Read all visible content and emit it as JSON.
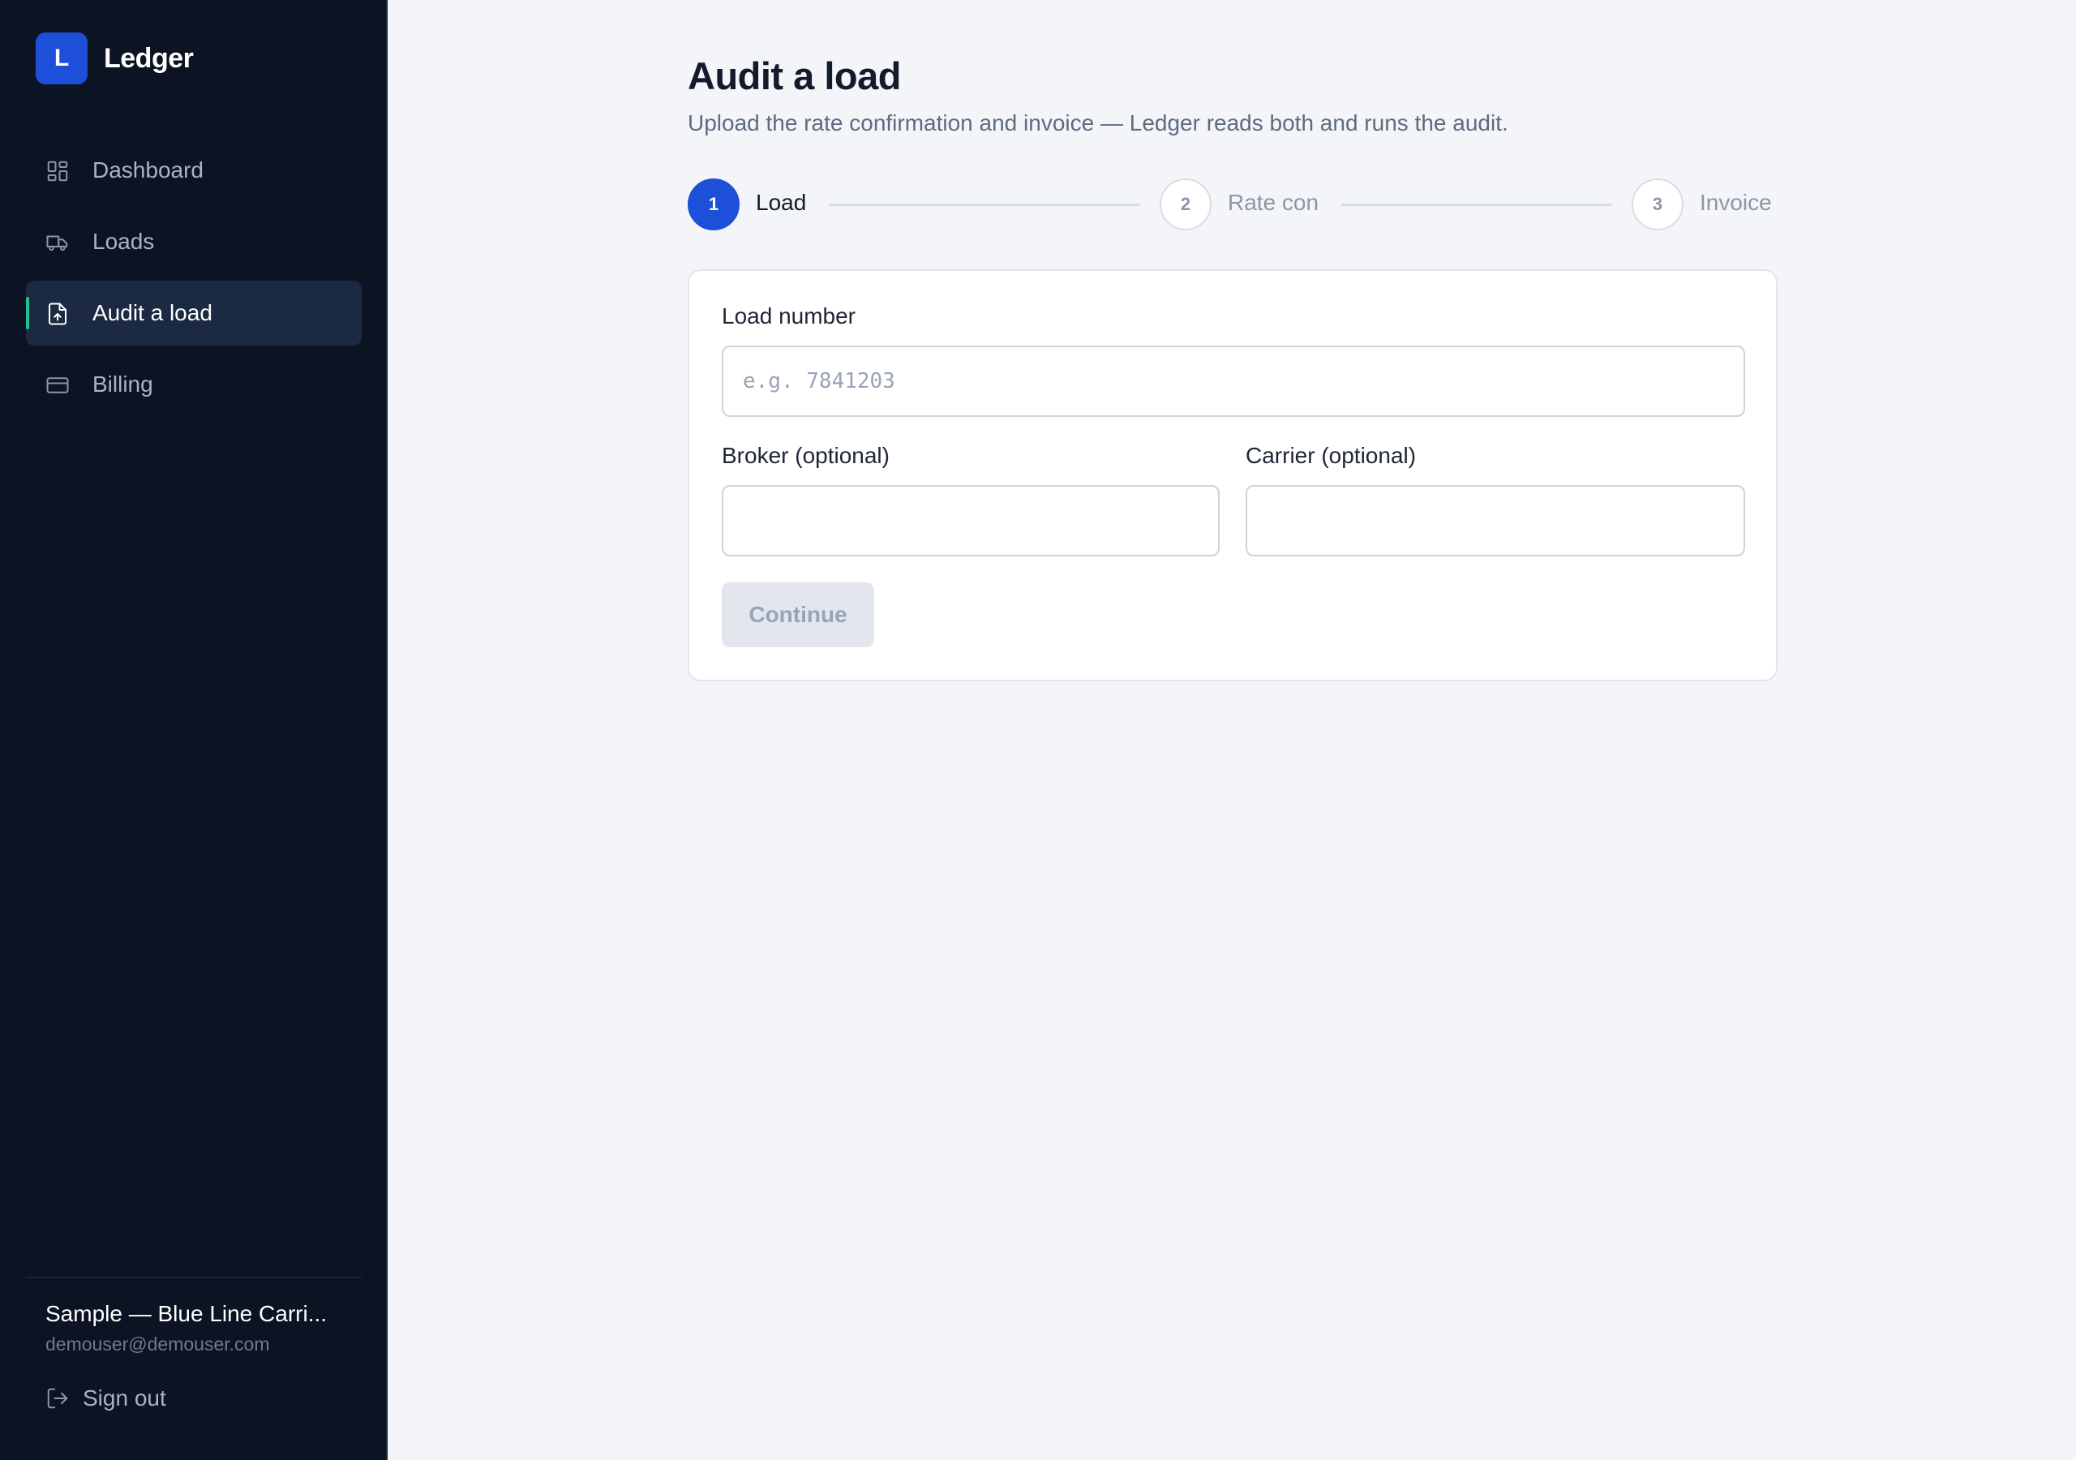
{
  "app": {
    "logo_letter": "L",
    "name": "Ledger"
  },
  "sidebar": {
    "items": [
      {
        "label": "Dashboard",
        "icon": "dashboard-icon",
        "active": false
      },
      {
        "label": "Loads",
        "icon": "truck-icon",
        "active": false
      },
      {
        "label": "Audit a load",
        "icon": "file-upload-icon",
        "active": true
      },
      {
        "label": "Billing",
        "icon": "credit-card-icon",
        "active": false
      }
    ],
    "account": {
      "name": "Sample — Blue Line Carri...",
      "email": "demouser@demouser.com"
    },
    "sign_out_label": "Sign out"
  },
  "page": {
    "title": "Audit a load",
    "subtitle": "Upload the rate confirmation and invoice — Ledger reads both and runs the audit."
  },
  "stepper": {
    "steps": [
      {
        "number": "1",
        "label": "Load",
        "active": true
      },
      {
        "number": "2",
        "label": "Rate con",
        "active": false
      },
      {
        "number": "3",
        "label": "Invoice",
        "active": false
      }
    ]
  },
  "form": {
    "load_number": {
      "label": "Load number",
      "value": "",
      "placeholder": "e.g. 7841203"
    },
    "broker": {
      "label": "Broker (optional)",
      "value": "",
      "placeholder": ""
    },
    "carrier": {
      "label": "Carrier (optional)",
      "value": "",
      "placeholder": ""
    },
    "continue_label": "Continue",
    "continue_disabled": true
  },
  "colors": {
    "sidebar_bg": "#0c1322",
    "accent": "#1e4fd8",
    "active_indicator": "#22c08d",
    "page_bg": "#f4f5f8"
  }
}
